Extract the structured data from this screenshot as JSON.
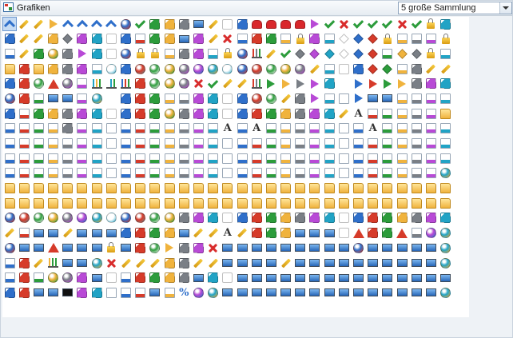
{
  "window": {
    "title": "Grafiken",
    "collection_selected": "5 große Sammlung"
  },
  "icon_grid": {
    "columns": 32,
    "rows": 20,
    "selected_index": 0,
    "visible_row_count": 20,
    "dominant_colors": [
      "#2f6fca",
      "#d63b2a",
      "#2c9c3b",
      "#f0b33d",
      "#7a7f86",
      "#b84ad6",
      "#21a3c5",
      "#ffffff"
    ],
    "icons": [
      "chevron-down-icon",
      "pencil-icon",
      "brush-icon",
      "up-arrow-icon",
      "double-up-arrow-icon",
      "double-left-icon",
      "double-right-icon",
      "double-up-icon",
      "gear-icon",
      "check-icon",
      "volume-icon",
      "volume-icon",
      "volume-icon",
      "film-icon",
      "brush-icon",
      "gradient-icon",
      "gradient-icon",
      "heart-icon",
      "heart-icon",
      "heart-icon",
      "heart-icon",
      "down-arrow-icon",
      "check-icon",
      "close-icon",
      "check-icon",
      "check-icon",
      "check-icon",
      "close-icon",
      "check-icon",
      "clock-icon",
      "eraser-icon",
      "",
      "palette-icon",
      "pencil-icon",
      "brush-icon",
      "paint-bucket-icon",
      "key-icon",
      "tools-icon",
      "palette-icon",
      "scissors-icon",
      "scissors-icon",
      "document-icon",
      "download-icon",
      "add-icon",
      "screen-icon",
      "volume-icon",
      "brush-icon",
      "close-icon",
      "document-icon",
      "dash-icon",
      "square-icon",
      "document-icon",
      "lock-icon",
      "palette-icon",
      "document-icon",
      "key-icon",
      "key-icon",
      "key-icon",
      "lock-icon",
      "document-icon",
      "document-icon",
      "document-icon",
      "clock-icon",
      "",
      "document-icon",
      "pencil-icon",
      "refresh-icon",
      "search-icon",
      "home-icon",
      "back-icon",
      "home-icon",
      "chat-icon",
      "help-icon",
      "clock-icon",
      "clock-icon",
      "document-icon",
      "magnet-icon",
      "chat-icon",
      "document-icon",
      "lock-icon",
      "settings-icon",
      "chart-icon",
      "pencil-icon",
      "check-icon",
      "tag-icon",
      "key-icon",
      "key-icon",
      "key-icon",
      "key-icon",
      "key-icon",
      "document-icon",
      "key-icon",
      "key-icon",
      "lock-icon",
      "document-icon",
      "",
      "folder-icon",
      "envelope-icon",
      "folder-icon",
      "chat-icon",
      "sound-icon",
      "refresh-icon",
      "document-icon",
      "gauge-icon",
      "refresh-icon",
      "orb-icon",
      "orb-icon",
      "orb-icon",
      "orb-icon",
      "orb-icon",
      "orb-icon",
      "orb-icon",
      "orb-icon",
      "orb-icon",
      "orb-icon",
      "orb-icon",
      "search-icon",
      "brush-icon",
      "document-icon",
      "dash-icon",
      "cart-icon",
      "tag-icon",
      "key-icon",
      "document-icon",
      "tools-icon",
      "pencil-icon",
      "pencil-icon",
      "",
      "envelope-icon",
      "refresh-icon",
      "info-icon",
      "warning-icon",
      "stop-icon",
      "clipboard-icon",
      "chart-icon",
      "signal-icon",
      "signal-icon",
      "mouse-icon",
      "orb-icon",
      "orb-icon",
      "search-icon",
      "close-icon",
      "check-icon",
      "pencil-icon",
      "pencil-icon",
      "bars-icon",
      "play-icon",
      "play-icon",
      "play-icon",
      "play-icon",
      "pause-icon",
      "play-icon",
      "back-icon",
      "back-icon",
      "rewind-icon",
      "next-icon",
      "shuffle-icon",
      "square-icon",
      "refresh-icon",
      "",
      "stop-icon",
      "music-icon",
      "document-icon",
      "screen-icon",
      "screen-icon",
      "document-icon",
      "settings-icon",
      "send-icon",
      "refresh-icon",
      "refresh-icon",
      "refresh-icon",
      "document-icon",
      "document-icon",
      "refresh-icon",
      "refresh-icon",
      "refresh-icon",
      "refresh-icon",
      "orb-icon",
      "search-icon",
      "brush-icon",
      "palette-icon",
      "play-icon",
      "document-icon",
      "document-icon",
      "arrow-icon",
      "screen-icon",
      "image-icon",
      "document-icon",
      "document-icon",
      "document-icon",
      "document-icon",
      "",
      "undo-icon",
      "document-icon",
      "list-icon",
      "grid-icon",
      "grid-icon",
      "grid-icon",
      "table-icon",
      "table-icon",
      "table-icon",
      "table-icon",
      "add-icon",
      "search-icon",
      "table-icon",
      "table-icon",
      "table-icon",
      "table-icon",
      "table-icon",
      "table-icon",
      "table-icon",
      "table-icon",
      "table-icon",
      "table-icon",
      "lightbulb-icon",
      "brush-icon",
      "font-icon",
      "document-icon",
      "document-icon",
      "document-icon",
      "document-icon",
      "document-icon",
      "folder-icon",
      "",
      "document-icon",
      "document-icon",
      "document-icon",
      "document-icon",
      "bomb-icon",
      "document-icon",
      "document-icon",
      "document-icon",
      "document-icon",
      "document-icon",
      "document-icon",
      "document-icon",
      "document-icon",
      "document-icon",
      "document-icon",
      "font-icon",
      "document-icon",
      "font-icon",
      "document-icon",
      "document-icon",
      "document-icon",
      "document-icon",
      "document-icon",
      "document-icon",
      "document-icon",
      "font-icon",
      "document-icon",
      "document-icon",
      "document-icon",
      "document-icon",
      "document-icon",
      "",
      "document-icon",
      "document-icon",
      "document-icon",
      "document-icon",
      "document-icon",
      "document-icon",
      "document-icon",
      "document-icon",
      "document-icon",
      "document-icon",
      "document-icon",
      "document-icon",
      "document-icon",
      "document-icon",
      "document-icon",
      "document-icon",
      "document-icon",
      "document-icon",
      "document-icon",
      "document-icon",
      "document-icon",
      "document-icon",
      "document-icon",
      "document-icon",
      "document-icon",
      "document-icon",
      "document-icon",
      "document-icon",
      "document-icon",
      "document-icon",
      "document-icon",
      "",
      "document-icon",
      "document-icon",
      "document-icon",
      "document-icon",
      "document-icon",
      "document-icon",
      "document-icon",
      "document-icon",
      "document-icon",
      "document-icon",
      "document-icon",
      "document-icon",
      "document-icon",
      "document-icon",
      "document-icon",
      "document-icon",
      "document-icon",
      "document-icon",
      "document-icon",
      "document-icon",
      "document-icon",
      "document-icon",
      "document-icon",
      "document-icon",
      "document-icon",
      "document-icon",
      "document-icon",
      "document-icon",
      "document-icon",
      "document-icon",
      "document-icon",
      "",
      "document-icon",
      "document-icon",
      "document-icon",
      "document-icon",
      "document-icon",
      "document-icon",
      "document-icon",
      "document-icon",
      "document-icon",
      "document-icon",
      "document-icon",
      "document-icon",
      "document-icon",
      "document-icon",
      "document-icon",
      "document-icon",
      "document-icon",
      "document-icon",
      "document-icon",
      "document-icon",
      "document-icon",
      "document-icon",
      "document-icon",
      "document-icon",
      "document-icon",
      "document-icon",
      "document-icon",
      "document-icon",
      "document-icon",
      "document-icon",
      "stop-icon",
      "",
      "folder-icon",
      "folder-icon",
      "folder-icon",
      "folder-icon",
      "folder-icon",
      "folder-icon",
      "folder-icon",
      "folder-icon",
      "folder-icon",
      "folder-icon",
      "folder-icon",
      "folder-icon",
      "folder-icon",
      "folder-icon",
      "folder-icon",
      "folder-icon",
      "folder-icon",
      "folder-icon",
      "folder-icon",
      "folder-icon",
      "folder-icon",
      "folder-icon",
      "folder-icon",
      "folder-icon",
      "folder-icon",
      "folder-icon",
      "folder-icon",
      "folder-icon",
      "folder-icon",
      "folder-icon",
      "folder-icon",
      "",
      "folder-icon",
      "folder-icon",
      "folder-icon",
      "folder-icon",
      "folder-icon",
      "folder-icon",
      "folder-icon",
      "folder-icon",
      "folder-icon",
      "folder-icon",
      "folder-icon",
      "folder-icon",
      "folder-icon",
      "folder-icon",
      "folder-icon",
      "folder-icon",
      "folder-icon",
      "folder-icon",
      "folder-icon",
      "folder-icon",
      "folder-icon",
      "folder-icon",
      "folder-icon",
      "folder-icon",
      "folder-icon",
      "folder-icon",
      "folder-icon",
      "folder-icon",
      "folder-icon",
      "folder-icon",
      "folder-icon",
      "",
      "disc-icon",
      "disc-icon",
      "disc-icon",
      "disc-icon",
      "disc-icon",
      "disc-icon",
      "disc-icon",
      "disc-icon",
      "disc-icon",
      "disc-icon",
      "disc-icon",
      "disc-icon",
      "phone-icon",
      "chip-icon",
      "drive-icon",
      "drive-icon",
      "drive-icon",
      "drive-icon",
      "drive-icon",
      "drive-icon",
      "drive-icon",
      "drive-icon",
      "drive-icon",
      "drive-icon",
      "drive-icon",
      "printer-icon",
      "printer-icon",
      "printer-icon",
      "printer-icon",
      "printer-icon",
      "printer-icon",
      "",
      "pencil-icon",
      "document-icon",
      "screen-icon",
      "screen-icon",
      "pencil-icon",
      "screen-icon",
      "screen-icon",
      "screen-icon",
      "download-icon",
      "user-icon",
      "user-icon",
      "user-icon",
      "film-icon",
      "pencil-icon",
      "pencil-icon",
      "font-icon",
      "brush-icon",
      "volume-icon",
      "sound-icon",
      "volume-icon",
      "screen-icon",
      "screen-icon",
      "screen-icon",
      "bell-icon",
      "warning-icon",
      "lightning-icon",
      "lightning-icon",
      "warning-icon",
      "book-icon",
      "settings-icon",
      "settings-icon",
      "",
      "info-icon",
      "screen-icon",
      "screen-icon",
      "warning-icon",
      "screen-icon",
      "screen-icon",
      "screen-icon",
      "clock-icon",
      "screen-icon",
      "tools-icon",
      "orb-icon",
      "play-icon",
      "tools-icon",
      "scissors-icon",
      "close-icon",
      "screen-icon",
      "screen-icon",
      "screen-icon",
      "screen-icon",
      "screen-icon",
      "screen-icon",
      "screen-icon",
      "screen-icon",
      "screen-icon",
      "settings-icon",
      "screen-icon",
      "screen-icon",
      "screen-icon",
      "screen-icon",
      "screen-icon",
      "stop-icon",
      "",
      "document-icon",
      "battery-icon",
      "pencil-icon",
      "chart-icon",
      "screen-icon",
      "screen-icon",
      "settings-icon",
      "close-icon",
      "pencil-icon",
      "pencil-icon",
      "pencil-icon",
      "grid-icon",
      "chip-icon",
      "pencil-icon",
      "pencil-icon",
      "screen-icon",
      "screen-icon",
      "screen-icon",
      "screen-icon",
      "pencil-icon",
      "screen-icon",
      "screen-icon",
      "screen-icon",
      "screen-icon",
      "screen-icon",
      "screen-icon",
      "screen-icon",
      "screen-icon",
      "screen-icon",
      "screen-icon",
      "stop-icon",
      "",
      "document-icon",
      "cactus-icon",
      "document-icon",
      "lifebuoy-icon",
      "sun-icon",
      "tools-icon",
      "screen-icon",
      "flag-icon",
      "document-icon",
      "tools-icon",
      "tools-icon",
      "tools-icon",
      "tools-icon",
      "screen-icon",
      "paint-bucket-icon",
      "tools-icon",
      "screen-icon",
      "screen-icon",
      "screen-icon",
      "screen-icon",
      "screen-icon",
      "screen-icon",
      "screen-icon",
      "screen-icon",
      "screen-icon",
      "screen-icon",
      "screen-icon",
      "screen-icon",
      "screen-icon",
      "screen-icon",
      "screen-icon",
      "",
      "tools-icon",
      "tools-icon",
      "screen-icon",
      "screen-icon",
      "terminal-icon",
      "chat-icon",
      "chat-icon",
      "document-icon",
      "document-icon",
      "document-icon",
      "screen-icon",
      "document-icon",
      "percent-icon",
      "orb-icon",
      "settings-icon",
      "screen-icon",
      "screen-icon",
      "screen-icon",
      "screen-icon",
      "screen-icon",
      "screen-icon",
      "screen-icon",
      "screen-icon",
      "screen-icon",
      "screen-icon",
      "screen-icon",
      "screen-icon",
      "screen-icon",
      "screen-icon",
      "screen-icon",
      "settings-icon",
      "",
      "",
      "",
      "",
      "",
      "",
      "",
      "",
      "",
      "",
      "",
      "",
      "",
      "",
      "",
      "",
      "",
      "",
      "",
      "",
      "",
      "",
      "",
      "",
      "",
      "",
      "",
      "",
      "",
      "",
      "",
      "",
      ""
    ]
  }
}
